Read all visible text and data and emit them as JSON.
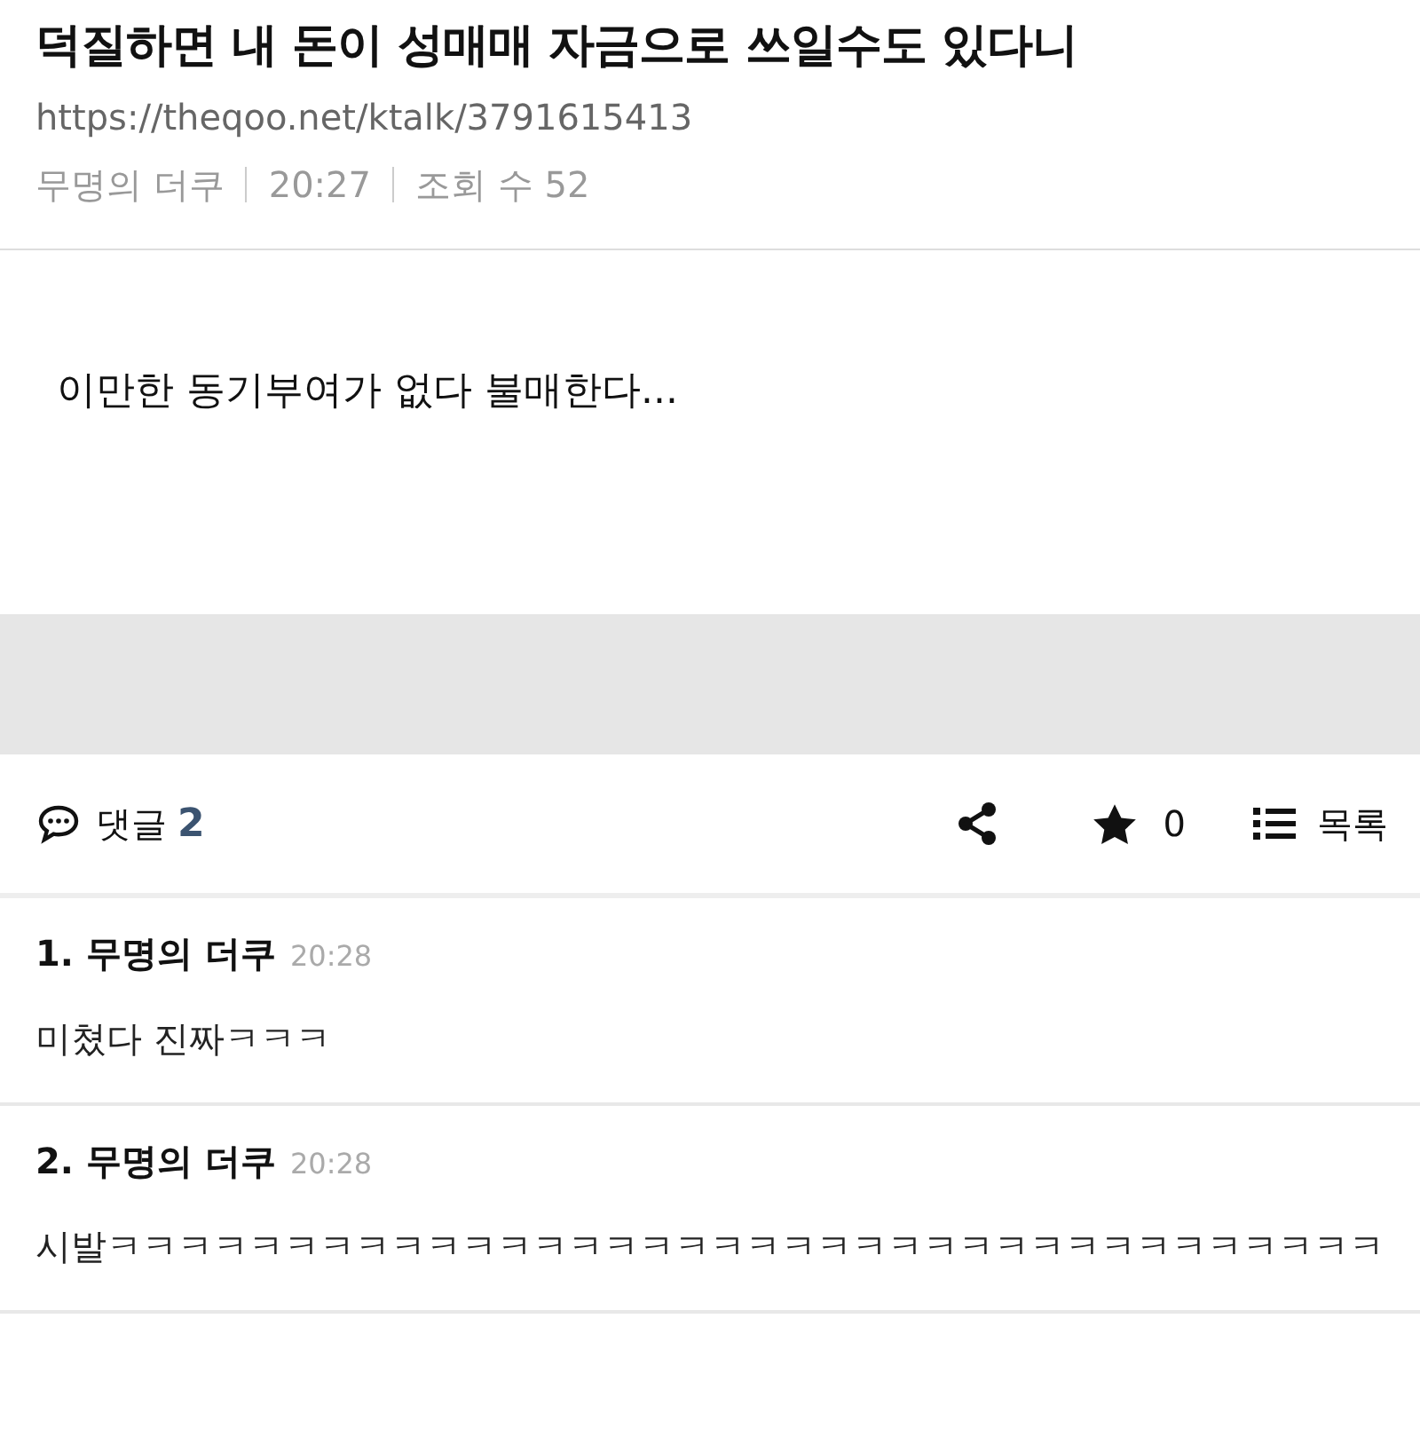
{
  "post": {
    "title": "덕질하면 내 돈이 성매매 자금으로 쓰일수도 있다니",
    "url": "https://theqoo.net/ktalk/3791615413",
    "author": "무명의 더쿠",
    "time": "20:27",
    "views": "조회 수 52",
    "body": "이만한 동기부여가 없다 불매한다..."
  },
  "toolbar": {
    "comments_label": "댓글",
    "comments_count": "2",
    "stars": "0",
    "list_label": "목록"
  },
  "comments": [
    {
      "header": "1. 무명의 더쿠",
      "time": "20:28",
      "text": "미쳤다 진짜ㅋㅋㅋ"
    },
    {
      "header": "2. 무명의 더쿠",
      "time": "20:28",
      "text": "시발ㅋㅋㅋㅋㅋㅋㅋㅋㅋㅋㅋㅋㅋㅋㅋㅋㅋㅋㅋㅋㅋㅋㅋㅋㅋㅋㅋㅋㅋㅋㅋㅋㅋㅋㅋㅋ"
    }
  ]
}
